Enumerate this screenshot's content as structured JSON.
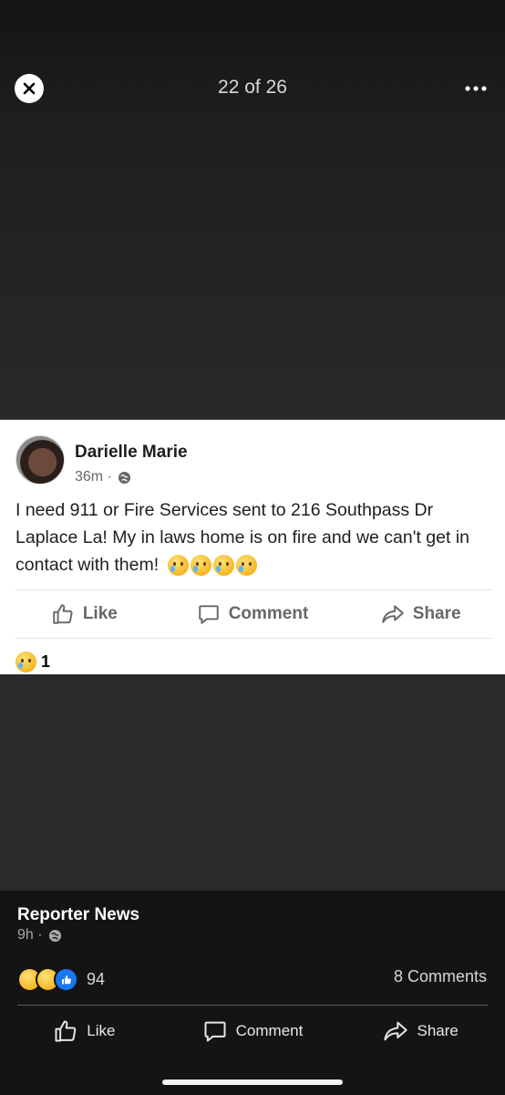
{
  "viewer": {
    "counter": "22 of 26",
    "close_icon": "close-icon",
    "more_icon": "more-horizontal-icon"
  },
  "post": {
    "author": "Darielle Marie",
    "time": "36m ·",
    "privacy_icon": "globe-icon",
    "text": "I need 911 or Fire Services sent to 216 Southpass Dr Laplace La! My in laws home is on fire and we can't get in contact with them!",
    "emoji_icons": [
      "crying-face-icon",
      "crying-face-icon",
      "crying-face-icon",
      "crying-face-icon"
    ],
    "actions": {
      "like": "Like",
      "comment": "Comment",
      "share": "Share"
    },
    "reaction_count": "1"
  },
  "panel": {
    "page_name": "Reporter News",
    "time": "9h ·",
    "reaction_count": "94",
    "comments": "8 Comments",
    "actions": {
      "like": "Like",
      "comment": "Comment",
      "share": "Share"
    }
  },
  "colors": {
    "like_blue": "#1877f2",
    "panel_bg": "#141416"
  }
}
